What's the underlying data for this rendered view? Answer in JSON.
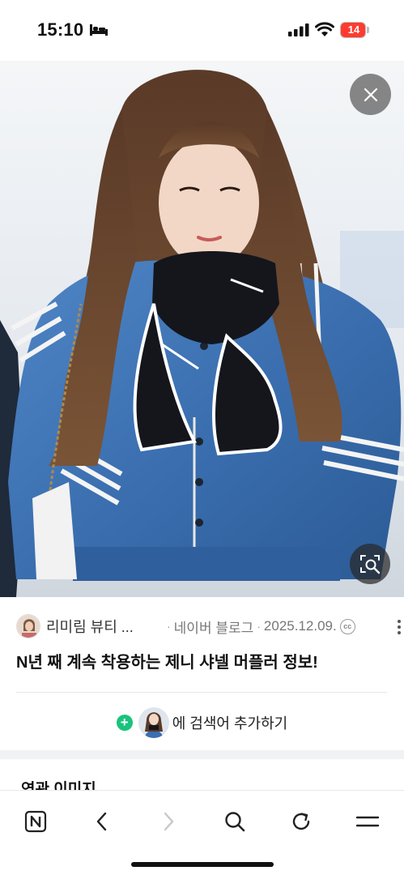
{
  "status_bar": {
    "time": "15:10",
    "battery_text": "14",
    "battery_level": 0.14
  },
  "image_viewer": {
    "close_icon": "close-icon",
    "lens_icon": "image-search-icon"
  },
  "result": {
    "source_name": "리미림 뷰티 ...",
    "separator": "·",
    "site": "네이버 블로그",
    "date": "2025.12.09.",
    "license_icon": "cc",
    "title": "N년 째 계속 착용하는 제니 샤넬 머플러 정보!"
  },
  "add_search": {
    "label": "에 검색어 추가하기",
    "plus": "+"
  },
  "related": {
    "title": "연관 이미지"
  },
  "toolbar": {
    "items": [
      "naver-home-icon",
      "back-icon",
      "forward-icon",
      "search-icon",
      "refresh-icon",
      "menu-icon"
    ]
  },
  "colors": {
    "accent_green": "#19c37d",
    "battery_red": "#ff3b30"
  }
}
